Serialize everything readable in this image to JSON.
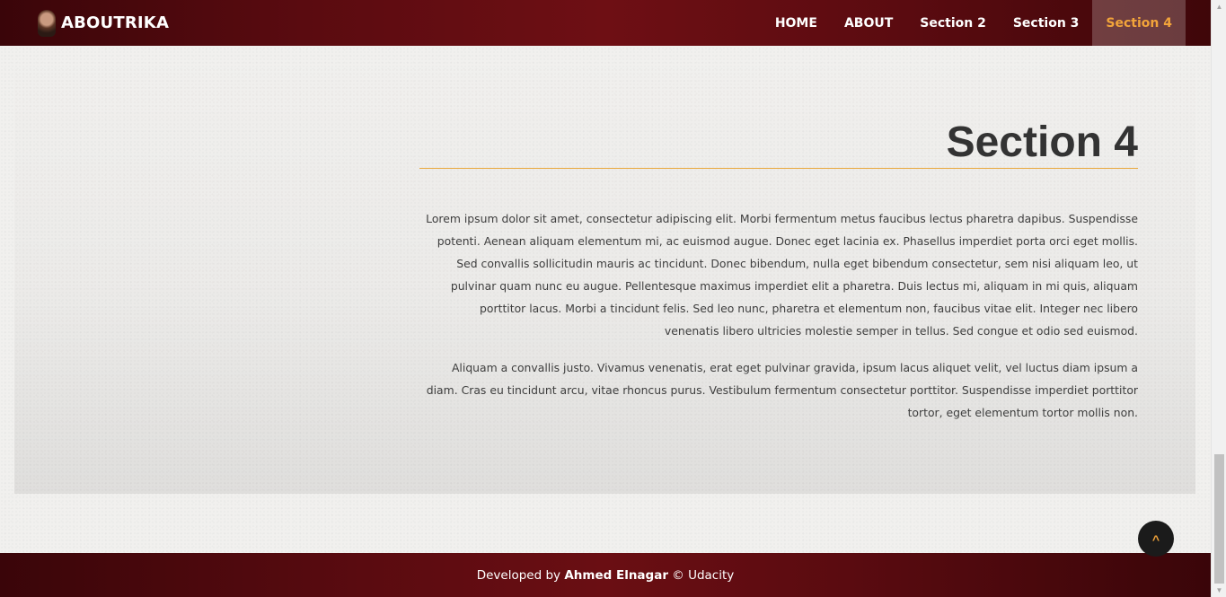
{
  "navbar": {
    "brand": "ABOUTRIKA",
    "items": [
      {
        "label": "HOME"
      },
      {
        "label": "ABOUT"
      },
      {
        "label": "Section 2"
      },
      {
        "label": "Section 3"
      },
      {
        "label": "Section 4"
      }
    ],
    "active_item": "Section 4",
    "active_color": "#f2a43a"
  },
  "section": {
    "heading": "Section 4",
    "accent_color": "#e9a83c",
    "paragraphs": [
      "Lorem ipsum dolor sit amet, consectetur adipiscing elit. Morbi fermentum metus faucibus lectus pharetra dapibus. Suspendisse potenti. Aenean aliquam elementum mi, ac euismod augue. Donec eget lacinia ex. Phasellus imperdiet porta orci eget mollis. Sed convallis sollicitudin mauris ac tincidunt. Donec bibendum, nulla eget bibendum consectetur, sem nisi aliquam leo, ut pulvinar quam nunc eu augue. Pellentesque maximus imperdiet elit a pharetra. Duis lectus mi, aliquam in mi quis, aliquam porttitor lacus. Morbi a tincidunt felis. Sed leo nunc, pharetra et elementum non, faucibus vitae elit. Integer nec libero venenatis libero ultricies molestie semper in tellus. Sed congue et odio sed euismod.",
      "Aliquam a convallis justo. Vivamus venenatis, erat eget pulvinar gravida, ipsum lacus aliquet velit, vel luctus diam ipsum a diam. Cras eu tincidunt arcu, vitae rhoncus purus. Vestibulum fermentum consectetur porttitor. Suspendisse imperdiet porttitor tortor, eget elementum tortor mollis non."
    ]
  },
  "to_top_button": {
    "label": "^",
    "icon": "caret-up-icon"
  },
  "footer": {
    "prefix": "Developed by",
    "author": "Ahmed Elnagar",
    "suffix": "© Udacity"
  },
  "colors": {
    "navbar_background": "#5a0b10",
    "footer_background": "#5a0b10",
    "page_background": "#f1f0ee"
  }
}
